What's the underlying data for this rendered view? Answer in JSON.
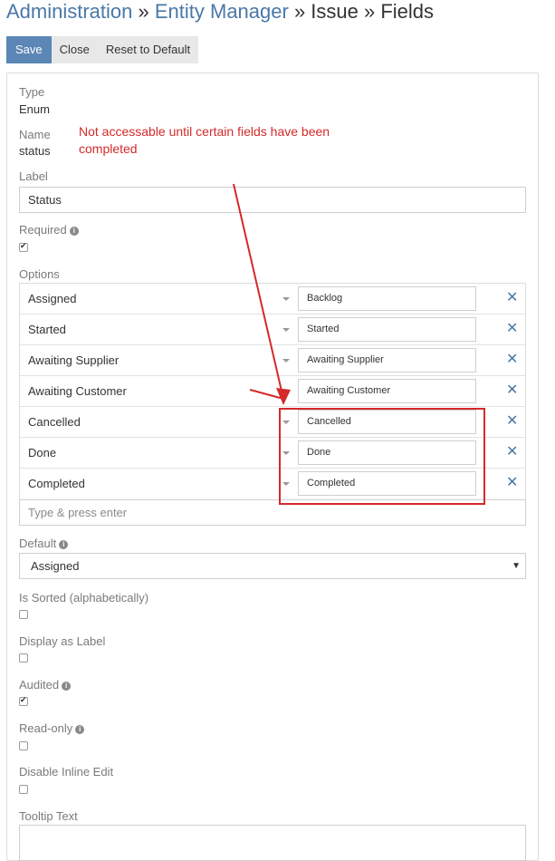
{
  "breadcrumb": {
    "admin": "Administration",
    "sep1": " » ",
    "entity_manager": "Entity Manager",
    "sep2": " » ",
    "issue": "Issue",
    "sep3": " » ",
    "fields": "Fields"
  },
  "toolbar": {
    "save": "Save",
    "close": "Close",
    "reset": "Reset to Default"
  },
  "field": {
    "type_label": "Type",
    "type_value": "Enum",
    "name_label": "Name",
    "name_value": "status",
    "annotation": "Not accessable until certain fields have been completed",
    "label_label": "Label",
    "label_value": "Status",
    "required_label": "Required",
    "required_checked": true,
    "options_label": "Options",
    "options": [
      {
        "name": "Assigned",
        "label": "Backlog"
      },
      {
        "name": "Started",
        "label": "Started"
      },
      {
        "name": "Awaiting Supplier",
        "label": "Awaiting Supplier"
      },
      {
        "name": "Awaiting Customer",
        "label": "Awaiting Customer"
      },
      {
        "name": "Cancelled",
        "label": "Cancelled"
      },
      {
        "name": "Done",
        "label": "Done"
      },
      {
        "name": "Completed",
        "label": "Completed"
      }
    ],
    "add_option_placeholder": "Type & press enter",
    "default_label": "Default",
    "default_value": "Assigned",
    "is_sorted_label": "Is Sorted (alphabetically)",
    "display_as_label_label": "Display as Label",
    "audited_label": "Audited",
    "audited_checked": true,
    "read_only_label": "Read-only",
    "disable_inline_edit_label": "Disable Inline Edit",
    "tooltip_label": "Tooltip Text"
  },
  "colors": {
    "primary": "#5b86b6",
    "link": "#4a78a8",
    "annotation_red": "#d42a2a"
  },
  "icons": {
    "info": "info-circle-icon",
    "remove": "remove-x-icon",
    "caret": "caret-down-icon"
  }
}
